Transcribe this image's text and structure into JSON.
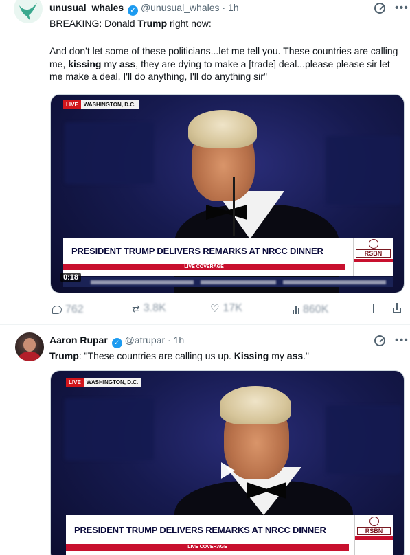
{
  "tweet1": {
    "display_name": "unusual_whales",
    "handle": "@unusual_whales",
    "separator": "·",
    "time": "1h",
    "text_parts": [
      {
        "t": "BREAKING: Donald ",
        "b": false
      },
      {
        "t": "Trump",
        "b": true
      },
      {
        "t": " right now:",
        "b": false
      }
    ],
    "text2_parts": [
      {
        "t": "And don't let some of these politicians...let me tell you. These countries are calling me, ",
        "b": false
      },
      {
        "t": "kissing",
        "b": true
      },
      {
        "t": " my ",
        "b": false
      },
      {
        "t": "ass",
        "b": true
      },
      {
        "t": ", they are dying to make a [trade] deal...please please sir let me make a deal, I'll do anything, I'll do anything sir\"",
        "b": false
      }
    ],
    "video": {
      "live_label": "LIVE",
      "location": "WASHINGTON, D.C.",
      "headline": "PRESIDENT TRUMP DELIVERS REMARKS AT NRCC DINNER",
      "red_bar_text": "LIVE COVERAGE",
      "brand": "RSBN",
      "timestamp": "0:18"
    },
    "actions": {
      "reply": "762",
      "repost": "3.8K",
      "like": "17K",
      "views": "860K"
    }
  },
  "tweet2": {
    "display_name": "Aaron Rupar",
    "handle": "@atrupar",
    "separator": "·",
    "time": "1h",
    "text_parts": [
      {
        "t": "Trump",
        "b": true
      },
      {
        "t": ": \"These countries are calling us up. ",
        "b": false
      },
      {
        "t": "Kissing",
        "b": true
      },
      {
        "t": " my ",
        "b": false
      },
      {
        "t": "ass",
        "b": true
      },
      {
        "t": ".\"",
        "b": false
      }
    ],
    "video": {
      "live_label": "LIVE",
      "location": "WASHINGTON, D.C.",
      "headline": "PRESIDENT TRUMP DELIVERS REMARKS AT NRCC DINNER",
      "red_bar_text": "LIVE COVERAGE",
      "brand": "RSBN"
    }
  },
  "icons": [
    "verified-badge-icon",
    "grok-icon",
    "more-icon",
    "reply-icon",
    "repost-icon",
    "like-icon",
    "views-icon",
    "bookmark-icon",
    "share-icon",
    "play-icon"
  ],
  "colors": {
    "accent": "#1d9bf0",
    "secondary_text": "#536471",
    "live_red": "#d1161c",
    "video_bg": "#161a4f"
  }
}
